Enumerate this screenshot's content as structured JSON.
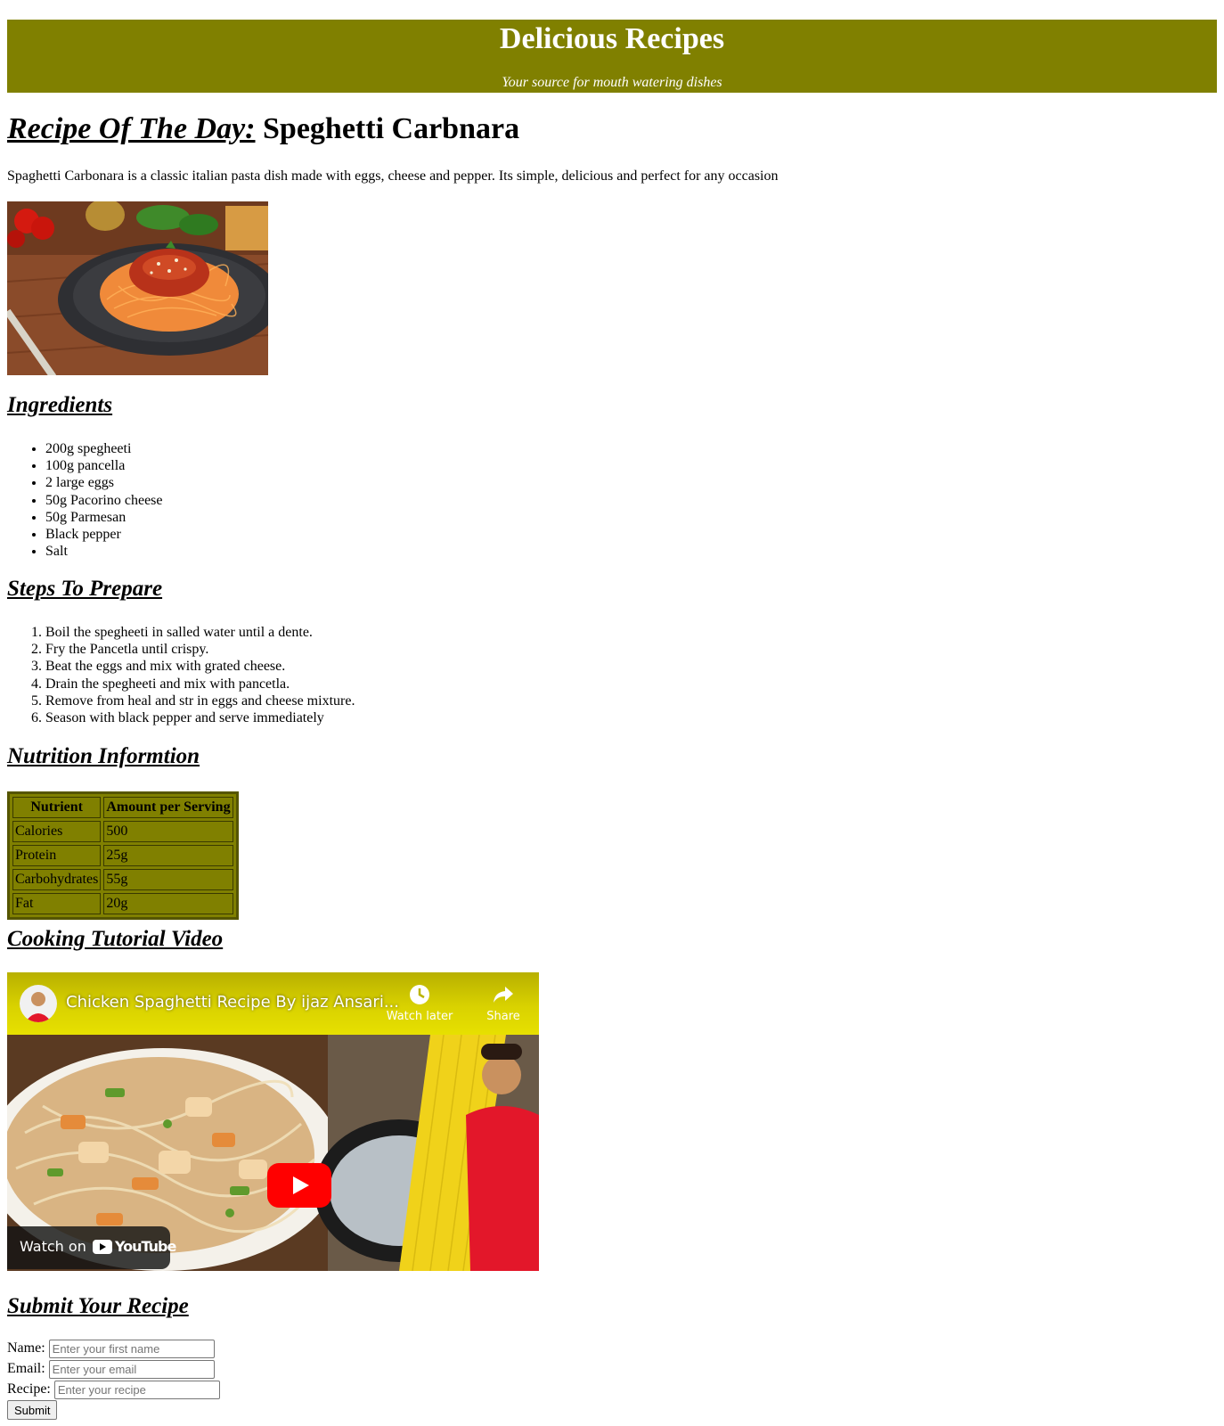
{
  "header": {
    "title": "Delicious Recipes",
    "tagline": "Your source for mouth watering dishes",
    "bg_color": "#808000"
  },
  "recipe_of_day": {
    "label": "Recipe Of The Day:",
    "name": "Speghetti Carbnara",
    "description": "Spaghetti Carbonara is a classic italian pasta dish made with eggs, cheese and pepper. Its simple, delicious and perfect for any occasion"
  },
  "ingredients": {
    "heading": "Ingredients",
    "items": [
      "200g spegheeti",
      "100g pancella",
      "2 large eggs",
      "50g Pacorino cheese",
      "50g Parmesan",
      "Black pepper",
      "Salt"
    ]
  },
  "steps": {
    "heading": "Steps To Prepare",
    "items": [
      "Boil the spegheeti in salled water until a dente.",
      "Fry the Pancetla until crispy.",
      "Beat the eggs and mix with grated cheese.",
      "Drain the spegheeti and mix with pancetla.",
      "Remove from heal and str in eggs and cheese mixture.",
      "Season with black pepper and serve immediately"
    ]
  },
  "nutrition": {
    "heading": "Nutrition Informtion",
    "columns": [
      "Nutrient",
      "Amount per Serving"
    ],
    "rows": [
      [
        "Calories",
        "500"
      ],
      [
        "Protein",
        "25g"
      ],
      [
        "Carbohydrates",
        "55g"
      ],
      [
        "Fat",
        "20g"
      ]
    ],
    "table_color": "#808000"
  },
  "video": {
    "heading": "Cooking Tutorial Video",
    "title": "Chicken Spaghetti Recipe By ijaz Ansari...",
    "watch_later": "Watch later",
    "share": "Share",
    "watch_on": "Watch on",
    "youtube": "YouTube",
    "icons": [
      "clock-icon",
      "share-icon",
      "play-button-icon",
      "youtube-logo-icon"
    ]
  },
  "submit_form": {
    "heading": "Submit Your Recipe",
    "name_label": "Name:",
    "name_placeholder": "Enter your first name",
    "email_label": "Email:",
    "email_placeholder": "Enter your email",
    "recipe_label": "Recipe:",
    "recipe_placeholder": "Enter your recipe",
    "submit_label": "Submit"
  }
}
